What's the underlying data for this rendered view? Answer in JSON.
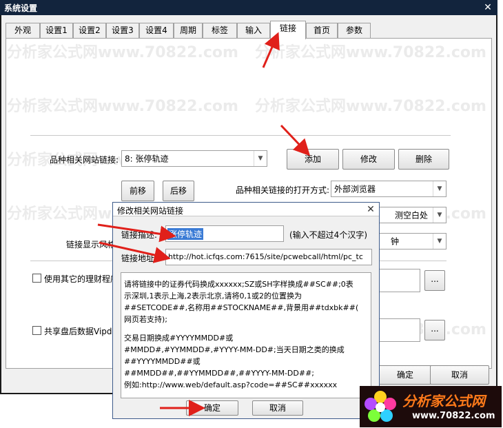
{
  "window": {
    "title": "系统设置"
  },
  "tabs": [
    {
      "label": "外观"
    },
    {
      "label": "设置1"
    },
    {
      "label": "设置2"
    },
    {
      "label": "设置3"
    },
    {
      "label": "设置4"
    },
    {
      "label": "周期"
    },
    {
      "label": "标签"
    },
    {
      "label": "输入"
    },
    {
      "label": "链接",
      "active": true
    },
    {
      "label": "首页"
    },
    {
      "label": "参数"
    }
  ],
  "watermark": "分析家公式网www.70822.com",
  "link_panel": {
    "site_link_label": "品种相关网站链接:",
    "site_link_value": "8: 张停轨迹",
    "add_label": "添加",
    "modify_label": "修改",
    "delete_label": "删除",
    "prev_label": "前移",
    "next_label": "后移",
    "open_mode_label": "品种相关链接的打开方式:",
    "open_mode_value": "外部浏览器",
    "second_combo_value": "测空白处",
    "display_label": "链接显示风格",
    "third_combo_value": "钟",
    "use_other_label": "使用其它的理财程序",
    "share_label": "共享盘后数据Vipd",
    "browse1": "...",
    "browse2": "...",
    "ok_label": "确定",
    "cancel_label": "取消"
  },
  "dialog": {
    "title": "修改相关网站链接",
    "desc_label": "链接描述:",
    "desc_value": "涨停轨迹",
    "desc_hint": "(输入不超过4个汉字)",
    "addr_label": "链接地址:",
    "addr_value": "http://hot.icfqs.com:7615/site/pcwebcall/html/pc_tc",
    "help_lines": [
      "请将链接中的证券代码换成xxxxxx;SZ或SH字样换成##SC##;0表",
      "示深圳,1表示上海,2表示北京,请将0,1或2的位置换为",
      "##SETCODE##,名称用##STOCKNAME##,背景用##tdxbk##(",
      "网页若支持);",
      "",
      "交易日期换成#YYYYMMDD#或",
      "#MMDD#,#YYMMDD#,#YYYY-MM-DD#;当天日期之类的换成",
      "##YYYYMMDD##或",
      "##MMDD##,##YYMMDD##,##YYYY-MM-DD##;",
      "例如:http://www.web/default.asp?code=##SC##xxxxxx"
    ],
    "ok_label": "确定",
    "cancel_label": "取消"
  },
  "logo": {
    "text": "分析家公式网",
    "url": "www.70822.com"
  },
  "colors": {
    "titlebar": "#12243d",
    "arrow": "#e0201a",
    "logo_text": "#ff7a1a"
  }
}
